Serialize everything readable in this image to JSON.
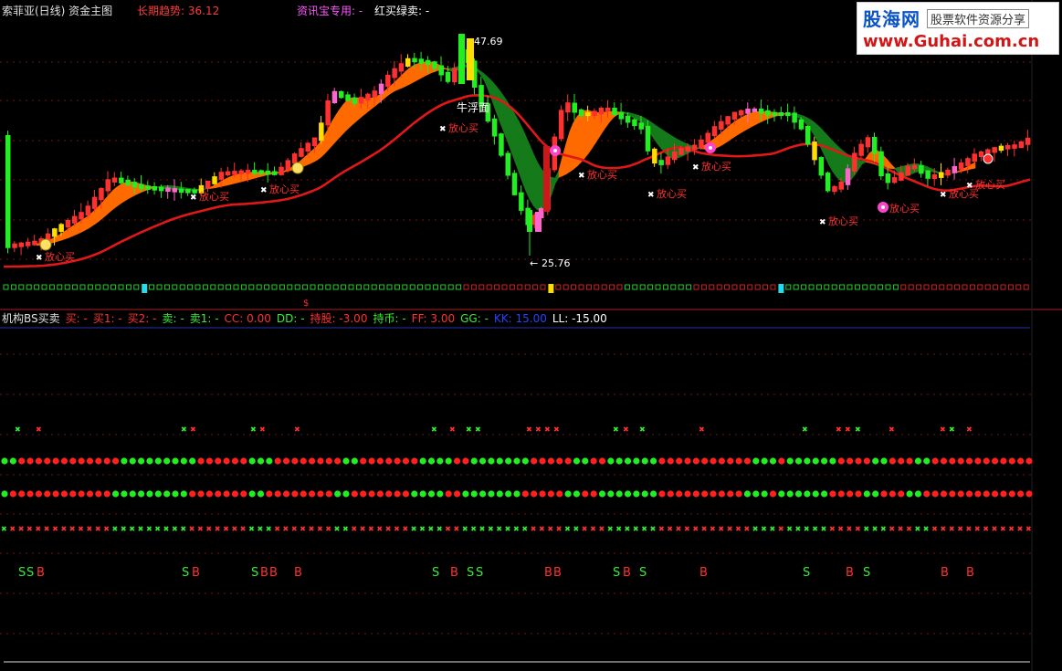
{
  "main_chart": {
    "title": "索菲亚(日线) 资金主图",
    "trend_label": "长期趋势: 36.12",
    "info_label": "资讯宝专用: -",
    "redgreen_label": "红买绿卖: -",
    "high_label": "47.69",
    "low_label": "25.76",
    "bull_label": "牛浮面",
    "buy_signal_label": "放心买",
    "dollar_mark": "$"
  },
  "watermark": {
    "brand": "股海网",
    "slogan": "股票软件资源分享",
    "url": "www.Guhai.com.cn"
  },
  "indicator": {
    "name": "机构BS买卖",
    "items": [
      {
        "label": "买: -",
        "color": "#ff3030"
      },
      {
        "label": "买1: -",
        "color": "#ff3030"
      },
      {
        "label": "买2: -",
        "color": "#ff3030"
      },
      {
        "label": "卖: -",
        "color": "#33ee33"
      },
      {
        "label": "卖1: -",
        "color": "#33ee33"
      },
      {
        "label": "CC: 0.00",
        "color": "#ff3030"
      },
      {
        "label": "DD: -",
        "color": "#33ee33"
      },
      {
        "label": "持股: -3.00",
        "color": "#ff3030"
      },
      {
        "label": "持币: -",
        "color": "#33ee33"
      },
      {
        "label": "FF: 3.00",
        "color": "#ff3030"
      },
      {
        "label": "GG: -",
        "color": "#33ee33"
      },
      {
        "label": "KK: 15.00",
        "color": "#2244ff"
      },
      {
        "label": "LL: -15.00",
        "color": "#ffffff"
      }
    ],
    "b_letter": "B",
    "s_letter": "S"
  },
  "colors": {
    "up": "#ff3030",
    "down": "#22ee22",
    "yellow": "#ffdd00",
    "pink": "#ff66cc",
    "orange": "#ff6a00",
    "dark_green": "#157a1a",
    "cyan": "#22ddee"
  }
}
